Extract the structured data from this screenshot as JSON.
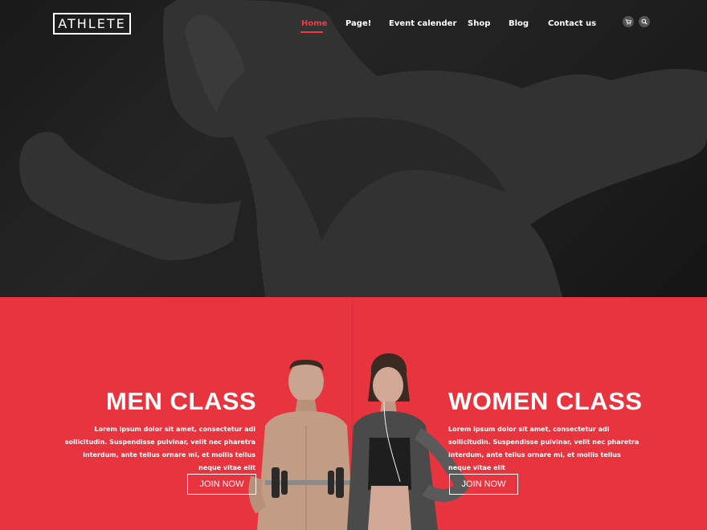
{
  "logo": {
    "text": "ATHLETE"
  },
  "nav": {
    "items": [
      {
        "label": "Home",
        "active": true
      },
      {
        "label": "Page!"
      },
      {
        "label": "Event calender"
      },
      {
        "label": "Shop"
      },
      {
        "label": "Blog"
      },
      {
        "label": "Contact us"
      }
    ],
    "icons": [
      "cart-icon",
      "search-icon"
    ]
  },
  "colors": {
    "accent": "#e8343f",
    "hero_bg": "#262626",
    "text": "#ffffff"
  },
  "men_class": {
    "title": "MEN CLASS",
    "text": "Lorem ipsum dolor sit amet, consectetur adi sollicitudin. Suspendisse pulvinar, velit nec pharetra interdum, ante tellus ornare mi, et mollis tellus neque vitae elit",
    "button": "JOIN NOW"
  },
  "women_class": {
    "title": "WOMEN CLASS",
    "text": "Lorem ipsum dolor sit amet, consectetur adi sollicitudin. Suspendisse pulvinar, velit nec pharetra interdum, ante tellus ornare mi, et mollis tellus neque vitae elit",
    "button": "JOIN NOW"
  }
}
